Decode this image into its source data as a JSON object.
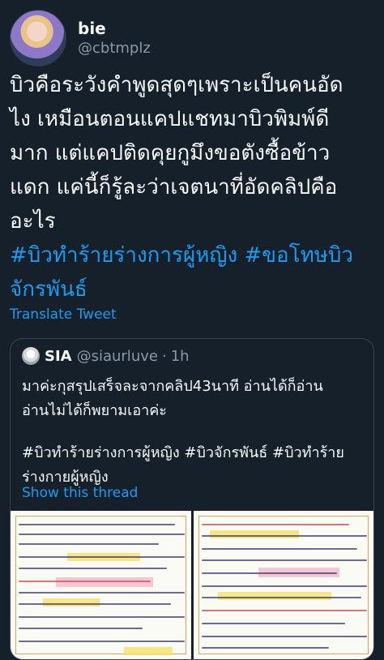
{
  "tweet": {
    "author_name": "bie",
    "author_handle": "@cbtmplz",
    "text_lines": [
      "บิวคือระวังคำพูดสุดๆเพราะเป็นคนอัด",
      "ไง เหมือนตอนแคปแชทมาบิวพิมพ์ดี",
      "มาก แต่แคปติดคุยกูมึงขอตังซื้อข้าว",
      "แดก แค่นี้ก็รู้ละว่าเจตนาที่อัดคลิปคือ",
      "อะไร"
    ],
    "hashtag_line_1": "#บิวทำร้ายร่างการผู้หญิง #ขอโทษบิว",
    "hashtag_line_2": "จักรพันธ์",
    "translate_label": "Translate Tweet"
  },
  "quoted": {
    "author_name": "SIA",
    "author_handle": "@siaurluve",
    "separator": "·",
    "time": "1h",
    "text_lines": [
      "มาค่ะกุสรุปเสร็จละจากคลิป43นาที อ่านได้ก็อ่าน",
      "อ่านไม่ได้ก็พยามเอาค่ะ"
    ],
    "hashtag_lines": [
      "#บิวทำร้ายร่างการผู้หญิง #บิวจักรพันธ์ #บิวทำร้าย",
      "ร่างกายผู้หญิง"
    ],
    "show_thread_label": "Show this thread",
    "images": [
      {
        "description_icon": "handwritten-notes-image"
      },
      {
        "description_icon": "handwritten-notes-image"
      }
    ]
  },
  "colors": {
    "background": "#15202b",
    "text": "#f7f9f9",
    "secondary": "#8b98a5",
    "accent": "#1d9bf0",
    "border": "#38444d"
  }
}
